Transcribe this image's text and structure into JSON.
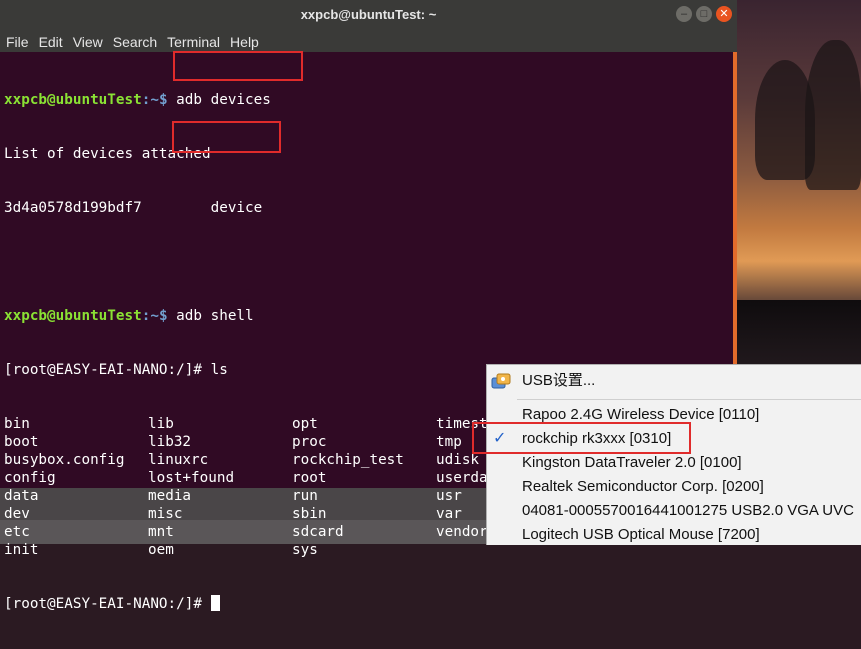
{
  "window": {
    "title": "xxpcb@ubuntuTest: ~",
    "buttons": [
      "–",
      "□",
      "✕"
    ]
  },
  "menu": [
    "File",
    "Edit",
    "View",
    "Search",
    "Terminal",
    "Help"
  ],
  "terminal": {
    "prompt_user": "xxpcb@ubuntuTest",
    "prompt_path": ":~$",
    "cmd1": "adb devices",
    "out1": "List of devices attached",
    "device_serial": "3d4a0578d199bdf7",
    "device_state": "device",
    "cmd2": "adb shell",
    "shell_prompt": "[root@EASY-EAI-NANO:/]#",
    "ls_cmd": "ls",
    "ls_rows": [
      [
        "bin",
        "lib",
        "opt",
        "timestamp"
      ],
      [
        "boot",
        "lib32",
        "proc",
        "tmp"
      ],
      [
        "busybox.config",
        "linuxrc",
        "rockchip_test",
        "udisk"
      ],
      [
        "config",
        "lost+found",
        "root",
        "userdata"
      ],
      [
        "data",
        "media",
        "run",
        "usr"
      ],
      [
        "dev",
        "misc",
        "sbin",
        "var"
      ],
      [
        "etc",
        "mnt",
        "sdcard",
        "vendor"
      ],
      [
        "init",
        "oem",
        "sys",
        ""
      ]
    ]
  },
  "usb_menu": {
    "settings": "USB设置...",
    "devices": [
      {
        "label": "Rapoo 2.4G Wireless Device [0110]",
        "checked": false
      },
      {
        "label": "rockchip rk3xxx [0310]",
        "checked": true
      },
      {
        "label": "Kingston DataTraveler 2.0 [0100]",
        "checked": false
      },
      {
        "label": "Realtek Semiconductor Corp.  [0200]",
        "checked": false
      },
      {
        "label": "04081-0005570016441001275 USB2.0 VGA UVC",
        "checked": false
      },
      {
        "label": "Logitech USB Optical Mouse [7200]",
        "checked": false
      }
    ]
  },
  "colors": {
    "terminal_bg": "#300a24",
    "prompt_user": "#8ae234",
    "prompt_path": "#729fcf",
    "highlight": "#e02b2b",
    "check": "#2563c9"
  }
}
